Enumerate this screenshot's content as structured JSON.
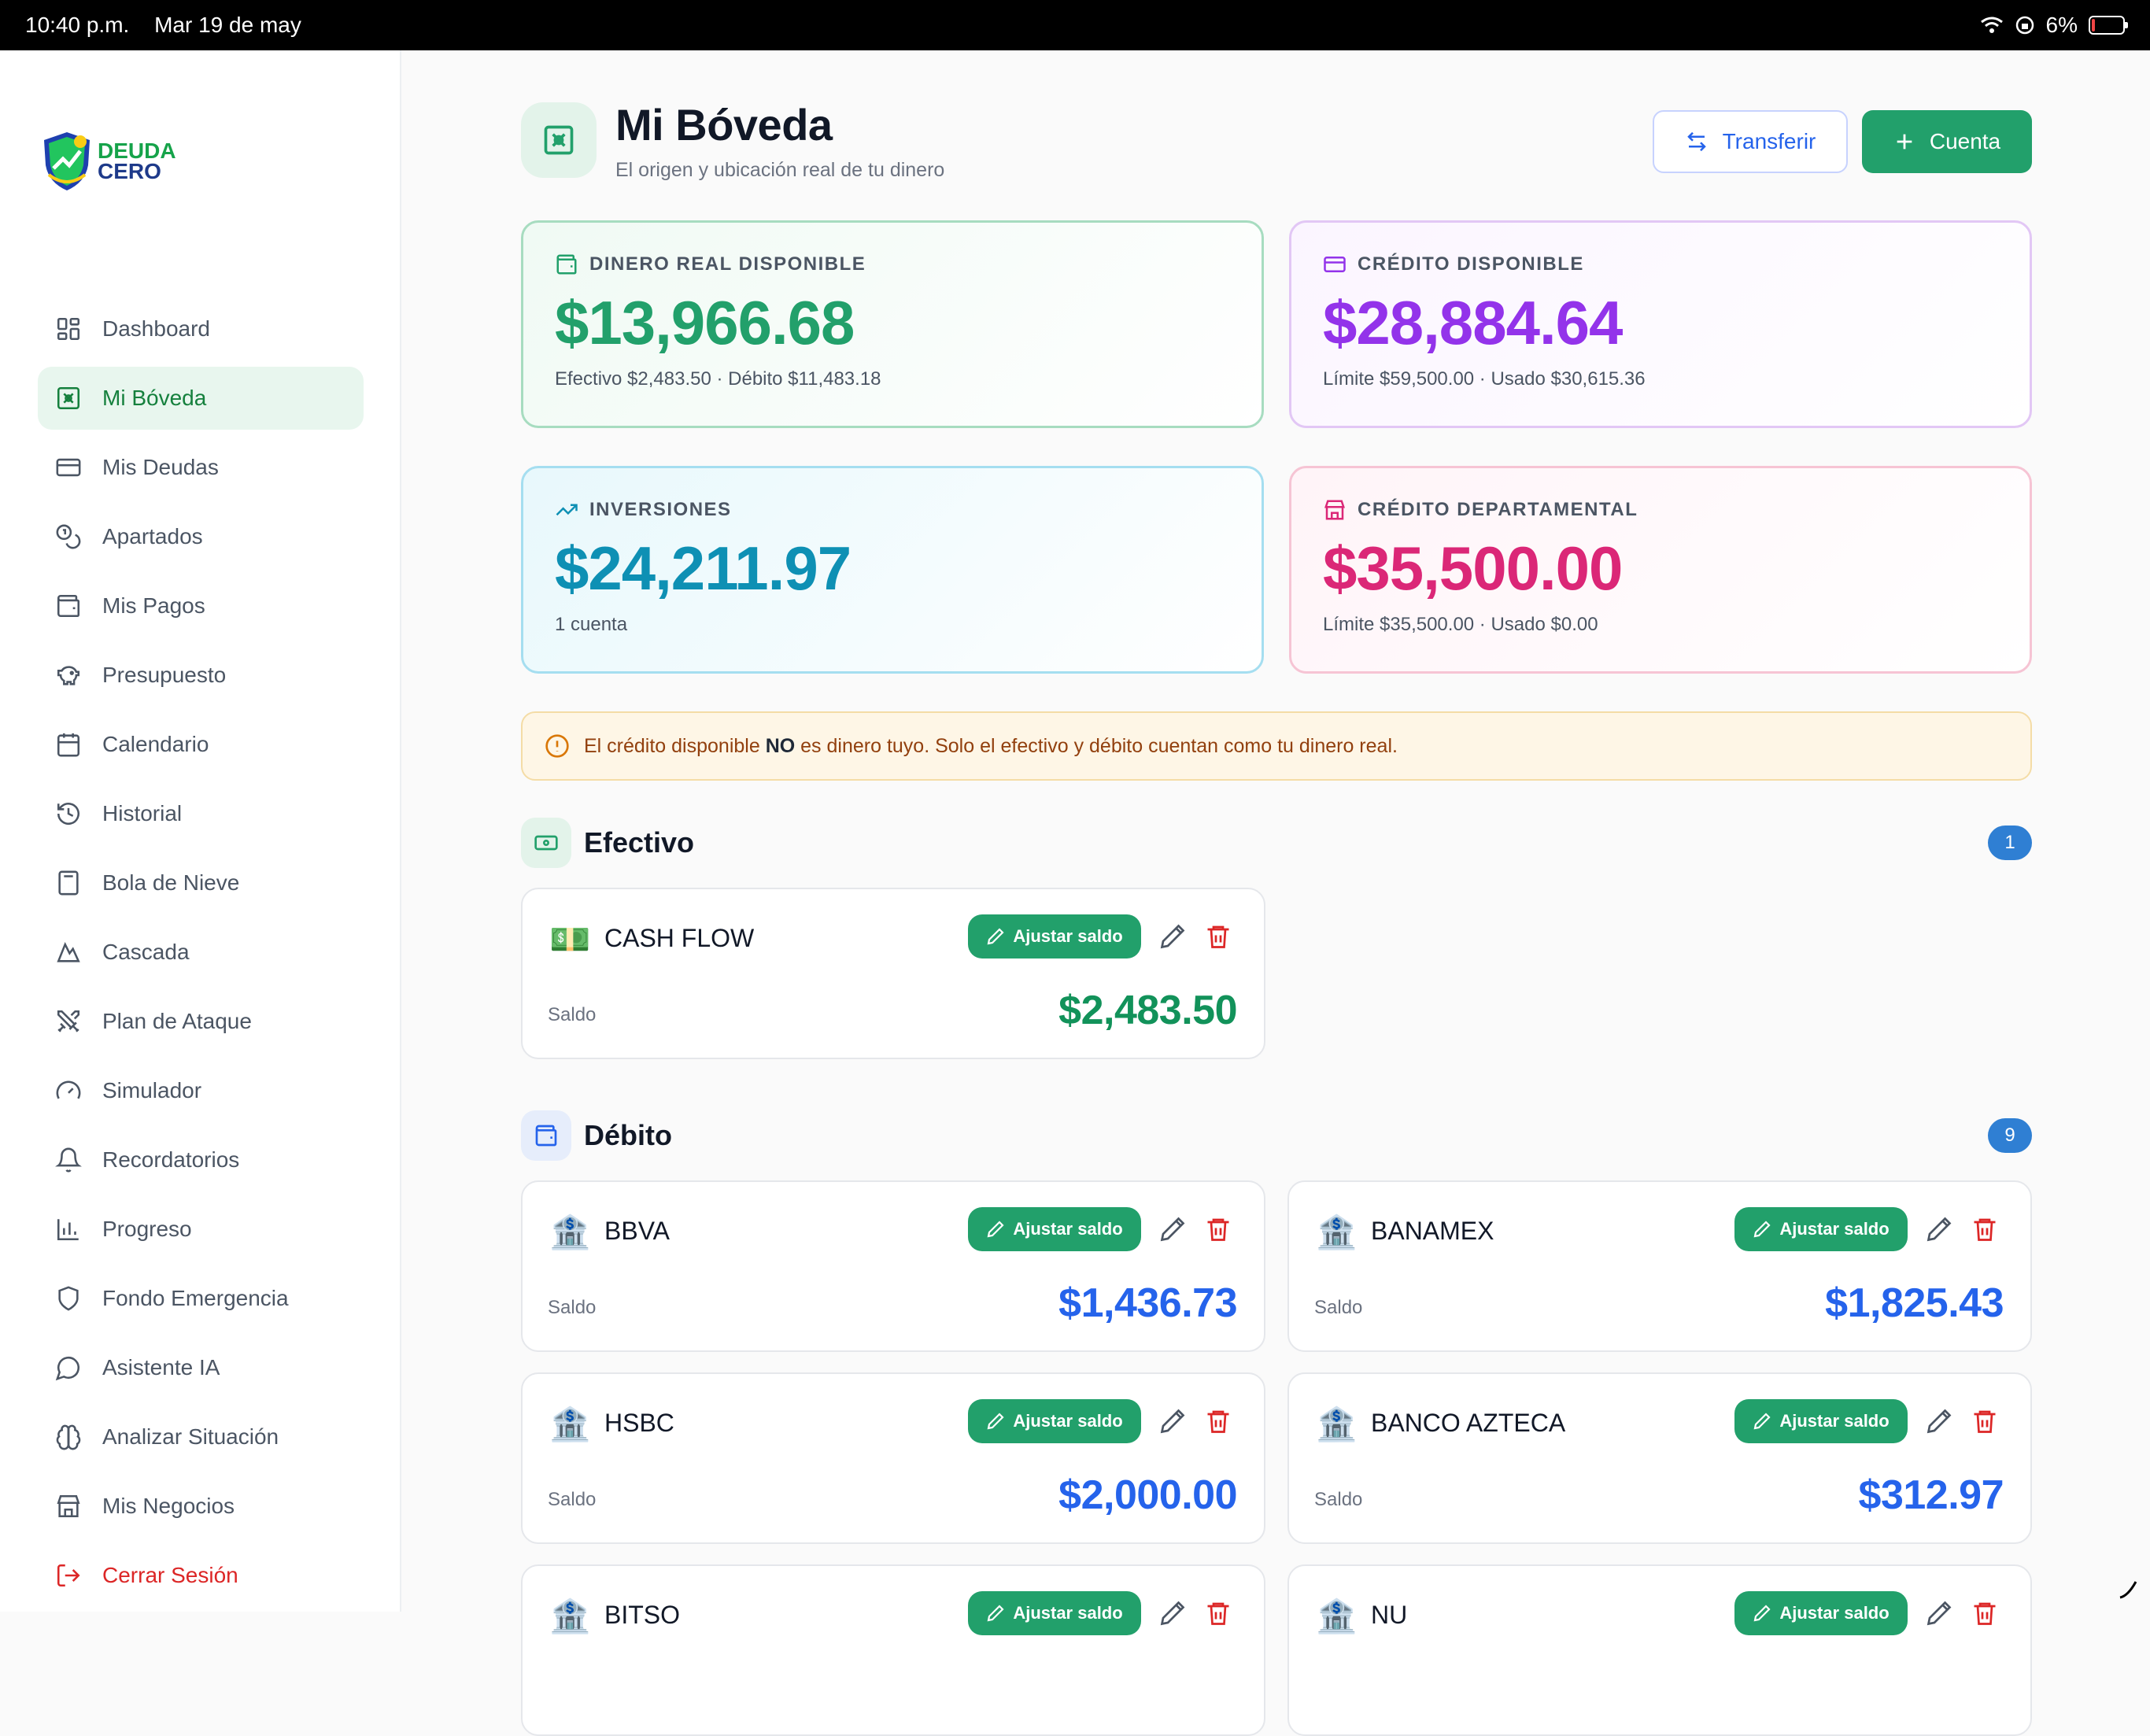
{
  "status_bar": {
    "time": "10:40 p.m.",
    "date": "Mar 19 de may",
    "battery": "6%"
  },
  "sidebar": {
    "logo": {
      "line1": "DEUDA",
      "line2": "CERO"
    },
    "items": [
      {
        "label": "Dashboard",
        "icon": "dashboard-icon"
      },
      {
        "label": "Mi Bóveda",
        "icon": "vault-icon",
        "active": true
      },
      {
        "label": "Mis Deudas",
        "icon": "credit-card-icon"
      },
      {
        "label": "Apartados",
        "icon": "coins-icon"
      },
      {
        "label": "Mis Pagos",
        "icon": "wallet-icon"
      },
      {
        "label": "Presupuesto",
        "icon": "piggy-bank-icon"
      },
      {
        "label": "Calendario",
        "icon": "calendar-icon"
      },
      {
        "label": "Historial",
        "icon": "history-icon"
      },
      {
        "label": "Bola de Nieve",
        "icon": "calculator-icon"
      },
      {
        "label": "Cascada",
        "icon": "mountain-icon"
      },
      {
        "label": "Plan de Ataque",
        "icon": "swords-icon"
      },
      {
        "label": "Simulador",
        "icon": "gauge-icon"
      },
      {
        "label": "Recordatorios",
        "icon": "bell-icon"
      },
      {
        "label": "Progreso",
        "icon": "bar-chart-icon"
      },
      {
        "label": "Fondo Emergencia",
        "icon": "shield-icon"
      },
      {
        "label": "Asistente IA",
        "icon": "chat-bubble-icon"
      },
      {
        "label": "Analizar Situación",
        "icon": "brain-icon"
      },
      {
        "label": "Mis Negocios",
        "icon": "store-icon"
      },
      {
        "label": "Cerrar Sesión",
        "icon": "logout-icon"
      }
    ]
  },
  "header": {
    "title": "Mi Bóveda",
    "subtitle": "El origen y ubicación real de tu dinero",
    "transfer_label": "Transferir",
    "add_account_label": "Cuenta"
  },
  "summary": {
    "real_money": {
      "label": "DINERO REAL DISPONIBLE",
      "value": "$13,966.68",
      "detail": "Efectivo $2,483.50 · Débito $11,483.18",
      "color": "#22a06b"
    },
    "credit": {
      "label": "CRÉDITO DISPONIBLE",
      "value": "$28,884.64",
      "detail": "Límite $59,500.00 · Usado $30,615.36",
      "color": "#9333ea"
    },
    "investments": {
      "label": "INVERSIONES",
      "value": "$24,211.97",
      "detail": "1 cuenta",
      "color": "#0e90b4"
    },
    "store_credit": {
      "label": "CRÉDITO DEPARTAMENTAL",
      "value": "$35,500.00",
      "detail": "Límite $35,500.00 · Usado $0.00",
      "color": "#db2777"
    }
  },
  "warning": {
    "before": "El crédito disponible ",
    "bold": "NO",
    "after": " es dinero tuyo. Solo el efectivo y débito cuentan como tu dinero real."
  },
  "common": {
    "adjust_label": "Ajustar saldo",
    "balance_label": "Saldo"
  },
  "sections": {
    "cash": {
      "title": "Efectivo",
      "count": "1",
      "accounts": [
        {
          "name": "CASH FLOW",
          "emoji": "💵",
          "balance": "$2,483.50"
        }
      ]
    },
    "debit": {
      "title": "Débito",
      "count": "9",
      "accounts": [
        {
          "name": "BBVA",
          "emoji": "🏦",
          "balance": "$1,436.73"
        },
        {
          "name": "BANAMEX",
          "emoji": "🏦",
          "balance": "$1,825.43"
        },
        {
          "name": "HSBC",
          "emoji": "🏦",
          "balance": "$2,000.00"
        },
        {
          "name": "BANCO AZTECA",
          "emoji": "🏦",
          "balance": "$312.97"
        },
        {
          "name": "BITSO",
          "emoji": "🏦",
          "balance": ""
        },
        {
          "name": "NU",
          "emoji": "🏦",
          "balance": ""
        }
      ]
    }
  }
}
